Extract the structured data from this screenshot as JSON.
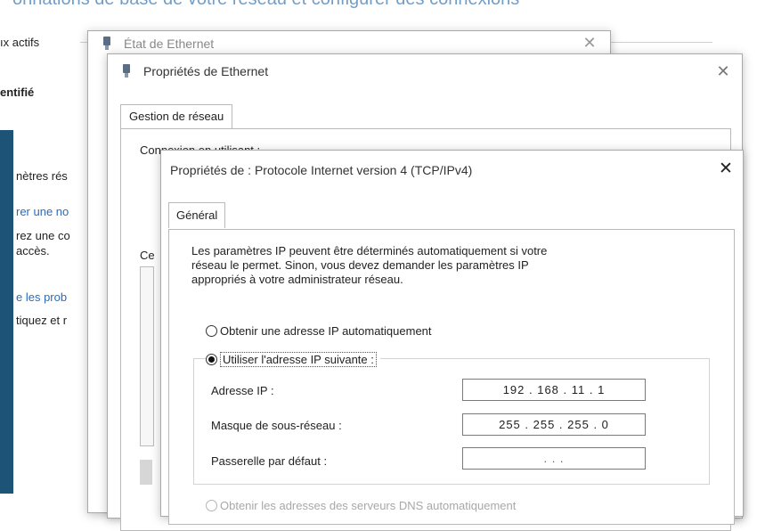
{
  "background": {
    "header_partial": "onnations de base de votre réseau et configurer des connexions",
    "active_networks_partial": "ıx actifs",
    "identified_partial": "entifié",
    "side_texts": [
      "nètres rés",
      "rer une no",
      "rez une co",
      "accès.",
      "e les prob",
      "tiquez et r"
    ]
  },
  "ethernet_status_window": {
    "title": "État de Ethernet"
  },
  "ethernet_properties_window": {
    "title": "Propriétés de Ethernet",
    "tab": "Gestion de réseau",
    "connect_label_partial": "Connexion en utilisant :",
    "list_label_partial": "Ce"
  },
  "ipv4_dialog": {
    "title": "Propriétés de : Protocole Internet version 4 (TCP/IPv4)",
    "close_glyph": "✕",
    "tab": "Général",
    "description": [
      "Les paramètres IP peuvent être déterminés automatiquement si votre",
      "réseau le permet. Sinon, vous devez demander les paramètres IP",
      "appropriés à votre administrateur réseau."
    ],
    "radio_auto_ip": "Obtenir une adresse IP automatiquement",
    "radio_manual_ip": "Utiliser l'adresse IP suivante :",
    "fields": [
      {
        "label": "Adresse IP :",
        "value": "192 . 168 .  11  .  1"
      },
      {
        "label": "Masque de sous-réseau :",
        "value": "255 . 255 . 255 .  0"
      },
      {
        "label": "Passerelle par défaut :",
        "value": ".        .        ."
      }
    ],
    "radio_auto_dns": "Obtenir les adresses des serveurs DNS automatiquement"
  }
}
